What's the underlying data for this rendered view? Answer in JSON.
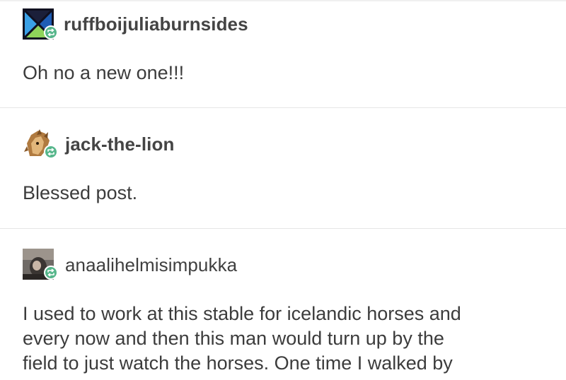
{
  "posts": [
    {
      "username": "ruffboijuliaburnsides",
      "avatar_icon": "crossed-triangles-avatar-icon",
      "badge_icon": "reblog-icon",
      "body_lines": [
        "Oh no a new one!!!"
      ]
    },
    {
      "username": "jack-the-lion",
      "avatar_icon": "lion-avatar-icon",
      "badge_icon": "reblog-icon",
      "body_lines": [
        "Blessed post."
      ]
    },
    {
      "username": "anaalihelmisimpukka",
      "avatar_icon": "photo-avatar-icon",
      "badge_icon": "reblog-icon",
      "body_lines": [
        "I used to work at this stable for icelandic horses and",
        "every now and then this man would turn up by the",
        "field to just watch the horses. One time I walked by"
      ]
    }
  ],
  "colors": {
    "reblog_badge": "#56b68b",
    "username": "#444444",
    "body_text": "#3c3c3c",
    "divider": "#e6e6e6"
  }
}
